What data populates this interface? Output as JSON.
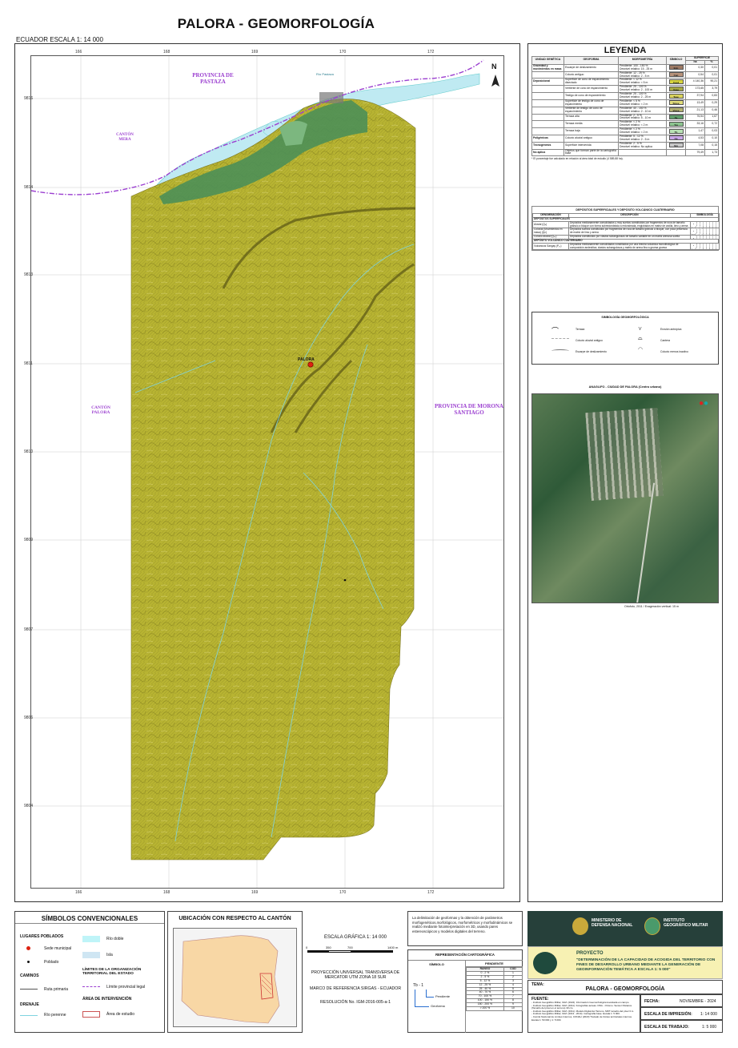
{
  "title": "PALORA - GEOMORFOLOGÍA",
  "scale_line": "ECUADOR  ESCALA    1: 14 000",
  "map": {
    "x_ticks": [
      "166",
      "168",
      "169",
      "170",
      "172"
    ],
    "y_ticks": [
      "9816",
      "9814",
      "9813",
      "9811",
      "9810",
      "9809",
      "9807",
      "9806",
      "9804"
    ],
    "north_label": "N",
    "places": {
      "pastaza": "PROVINCIA DE PASTAZA",
      "mera": "CANTÓN MERA",
      "palora_canton": "CANTÓN PALORA",
      "morona": "PROVINCIA DE MORONA SANTIAGO",
      "palora_town": "PALORA",
      "river": "Río Pastaza"
    },
    "colors": {
      "river": "#bfeaf2",
      "terrain": "#b8b432",
      "terrain_dark": "#8f8a22",
      "green": "#4d8f56",
      "boundary": "#9b3fd0"
    }
  },
  "legend": {
    "title": "LEYENDA",
    "geo_headers": [
      "UNIDAD GENÉTICA",
      "GEOFORMA",
      "MORFOMETRÍA",
      "SÍMBOLO",
      "SUPERFICIE",
      "ha",
      "%"
    ],
    "geo_rows": [
      {
        "unit": "Gravedad y movimientos en masa",
        "form": "Escarpe de deslizamiento",
        "morpho": "Pendiente: 100 - 150 %\nDesnivel relativo: 15 - 25 m",
        "sym": "Edo",
        "color": "#9e7a64",
        "ha": "0,30",
        "pct": "0,01"
      },
      {
        "unit": "",
        "form": "Coluvio antiguo",
        "morpho": "Pendiente: 12 - 25 %\nDesnivel relativo: 2 - 5 m",
        "sym": "Can",
        "color": "#b7927a",
        "ha": "0,54",
        "pct": "0,01"
      },
      {
        "unit": "Deposicional",
        "form": "Superficie de cono de esparcimiento disectado",
        "morpho": "Pendiente: < 12 %\nDesnivel relativo: < 5 m",
        "sym": "Cesd",
        "color": "#d7d43e",
        "ha": "4 140,36",
        "pct": "90,21"
      },
      {
        "unit": "",
        "form": "Vertiente de cono de esparcimiento",
        "morpho": "Pendiente: 25 - 100 %\nDesnivel relativo: 2 - 100 m",
        "sym": "Vcee",
        "color": "#a6a845",
        "ha": "173,65",
        "pct": "3,79"
      },
      {
        "unit": "",
        "form": "Testigo de cono de esparcimiento",
        "morpho": "Pendiente: 25 - 100 %\nDesnivel relativo: 2 - 25 m",
        "sym": "Tcee",
        "color": "#d9d35c",
        "ha": "37,94",
        "pct": "0,83"
      },
      {
        "unit": "",
        "form": "Superficie de testigo de cono de esparcimiento",
        "morpho": "Pendiente: < 5 %\nDesnivel relativo: < 2 m",
        "sym": "Stcee",
        "color": "#e0dc7a",
        "ha": "13,49",
        "pct": "0,29"
      },
      {
        "unit": "",
        "form": "Vertiente de testigo de cono de esparcimiento",
        "morpho": "Pendiente: 40 - 150 %\nDesnivel relativo: 2 - 10 m",
        "sym": "Vtcee",
        "color": "#b5b470",
        "ha": "21,13",
        "pct": "0,46"
      },
      {
        "unit": "",
        "form": "Terraza alta",
        "morpho": "Pendiente: 2 - 5 %\nDesnivel relativo: 5 - 10 m",
        "sym": "Ta",
        "color": "#5f9e6a",
        "ha": "76,54",
        "pct": "1,67"
      },
      {
        "unit": "",
        "form": "Terraza media",
        "morpho": "Pendiente: < 2 %\nDesnivel relativo: < 2 m",
        "sym": "Tm",
        "color": "#8cc48f",
        "ha": "33,16",
        "pct": "0,72"
      },
      {
        "unit": "",
        "form": "Terraza baja",
        "morpho": "Pendiente: < 2 %\nDesnivel relativo: < 2 m",
        "sym": "Tb",
        "color": "#b9e3b5",
        "ha": "1,47",
        "pct": "0,03"
      },
      {
        "unit": "Poligénicas",
        "form": "Coluvio aluvial antiguo",
        "morpho": "Pendiente: 5 - 12 %\nDesnivel relativo: 2 - 5 m",
        "sym": "Ca",
        "color": "#c9a6e8",
        "ha": "4,53",
        "pct": "0,10"
      },
      {
        "unit": "Tecnogénesis",
        "form": "Superficie intervenida",
        "morpho": "Pendiente: 2 - 5 %\nDesnivel relativo: No aplica",
        "sym": "Sin",
        "color": "#c8c8c8",
        "ha": "7,08",
        "pct": "0,15"
      },
      {
        "unit": "No aplica",
        "form": "Objetos que forman parte de la cartografía base",
        "morpho": "",
        "sym": "",
        "color": "#ffffff",
        "ha": "79,49",
        "pct": "1,73"
      }
    ],
    "geo_note": "* El porcentaje fue calculado en relación al área total de estudio (4 589,88 ha).",
    "dep_title": "DEPÓSITOS SUPERFICIALES Y DEPÓSITO VOLCÁNICO CUATERNARIO",
    "dep_headers": [
      "DENOMINACIÓN",
      "DESCRIPCIÓN",
      "SIMBOLOGÍA"
    ],
    "dep_section1": "DEPÓSITOS SUPERFICIALES",
    "dep_rows1": [
      {
        "name": "Aluvial (Qₐ)",
        "desc": "Depósitos medianamente consolidados y muy sueltos constituidos por fragmentos de roca de tamaño grânulo a bloque con forma subredondeada a redondeada, englobados en matriz de arcilla, limo y arena"
      },
      {
        "name": "Coluvial (Movimientos en masa) (Qc)",
        "desc": "Depósitos sueltos constituidos por fragmentos de roca de tamaño grânulo a bloque, con poca presencia de matriz de limo y arena"
      },
      {
        "name": "Coluvio aluvial (Qₐₐ)",
        "desc": "Depósitos constituidos por clastos subangulosos de tamaño variable en un matriz arenosa suelta"
      }
    ],
    "dep_section2": "DEPÓSITO VOLCÁNICO CUATERNARIO",
    "dep_rows2": [
      {
        "name": "Volcánicos Sangay (P₂ₛ)",
        "desc": "Depósitos medianamente consolidados constituidos por una brecha volcánica monolitológica de composición andesítica; clastos subangulosos y matriz de arena fina a gruesa gruesa"
      }
    ],
    "symb_title": "SIMBOLOGÍA GEOMORFOLÓGICA",
    "symb_items": [
      "Terraza",
      "Erosión antrópica",
      "Coluvio aluvial antiguo",
      "Cantera",
      "Escarpe de deslizamiento",
      "Coluvio menos inactivo"
    ],
    "anaglifo_title": "ANAGLIFO - CIUDAD DE PALORA (Centro urbano)",
    "anaglifo_note": "Ortofoto, 2011 / Exageración vertical: 15 m"
  },
  "simbolos": {
    "title": "SÍMBOLOS CONVENCIONALES",
    "lugares": "LUGARES POBLADOS",
    "sede": "Sede municipal",
    "poblado": "Poblado",
    "caminos": "CAMINOS",
    "ruta": "Ruta primaria",
    "drenaje": "DRENAJE",
    "rio_perenne": "Río perenne",
    "rio_doble": "Río doble",
    "isla": "Isla",
    "limites": "LÍMITES DE LA ORGANIZACIÓN TERRITORIAL DEL ESTADO",
    "limite_prov": "Límite provincial legal",
    "area": "ÁREA DE INTERVENCIÓN",
    "area_estudio": "Área de estudio"
  },
  "ubicacion": {
    "title": "UBICACIÓN CON RESPECTO AL CANTÓN"
  },
  "escala": {
    "grafica": "ESCALA GRÁFICA   1: 14 000",
    "ticks": [
      "0",
      "350",
      "700",
      "1400 m"
    ],
    "proyeccion": "PROYECCIÓN UNIVERSAL TRANSVERSA DE MERCATOR UTM ZONA 18 SUR",
    "marco": "MARCO DE REFERENCIA SIRGAS - ECUADOR",
    "resolucion": "RESOLUCIÓN No. IGM-2016-005-a-1"
  },
  "metodo": "La delimitación de geoformas y la obtención de parámetros morfogenéticos,morfológicos, morfométricos y morfodinámicos se realizó mediante fotointerpretación en 3D, usando pares estereoscópicos y modelos digitales del terreno.",
  "representacion": {
    "title": "REPRESENTACIÓN CARTOGRÁFICA",
    "simbolo": "SÍMBOLO",
    "pendiente": "PENDIENTE",
    "rango": "RANGO",
    "cod": "COD",
    "example": "Tb - 1",
    "pend_label": "Pendiente",
    "geo_label": "Geoforma",
    "rows": [
      [
        "0 - 2 %",
        "1"
      ],
      [
        "2 - 5 %",
        "2"
      ],
      [
        "5 - 12 %",
        "3"
      ],
      [
        "12 - 25 %",
        "4"
      ],
      [
        "25 - 40 %",
        "5"
      ],
      [
        "40 - 70 %",
        "6"
      ],
      [
        "70 - 100 %",
        "7"
      ],
      [
        "100 - 150 %",
        "8"
      ],
      [
        "150 - 200 %",
        "9"
      ],
      [
        "> 200 %",
        "10"
      ]
    ]
  },
  "institucion": {
    "ministerio": "MINISTERIO DE DEFENSA NACIONAL",
    "instituto": "INSTITUTO GEOGRÁFICO MILITAR",
    "proyecto_label": "PROYECTO",
    "proyecto": "\"DETERMINACIÓN DE LA CAPACIDAD DE ACOGIDA DEL TERRITORIO CON FINES DE DESARROLLO URBANO MEDIANTE LA GENERACIÓN DE GEOINFORMACIÓN TEMÁTICA A ESCALA 1: 5 000\"",
    "tema_label": "TEMA:",
    "tema": "PALORA - GEOMORFOLOGÍA",
    "fuente_label": "FUENTE:",
    "fuentes": [
      "- Instituto Geográfico Militar, IGM. (2024). Información Geomorfológica levantada en campo.",
      "- Instituto Geográfico Militar, IGM. (2011). Fotografías aéreas. DSG - Ortomo. Sensor Distance (Tamaño del píxel en el terreno) 30 cm.",
      "- Instituto Geográfico Militar, IGM. (2011). Modelo Digital del Terreno, MDT tamaño del píxel 3 m.",
      "- Instituto Geográfico Militar, IGM. (2013 - 2014). Cartografía base. Escala 1: 5 000.",
      "- Comité Nacional de Límites Internos, CONALI (2023) Trazado de límites territoriales internos. Escala 1: 50 000 y 1: 5 000."
    ],
    "fecha_label": "FECHA:",
    "fecha": "NOVIEMBRE - 2024",
    "imp_label": "ESCALA DE IMPRESIÓN:",
    "imp": "1: 14 000",
    "trab_label": "ESCALA DE TRABAJO:",
    "trab": "1: 5 000"
  }
}
